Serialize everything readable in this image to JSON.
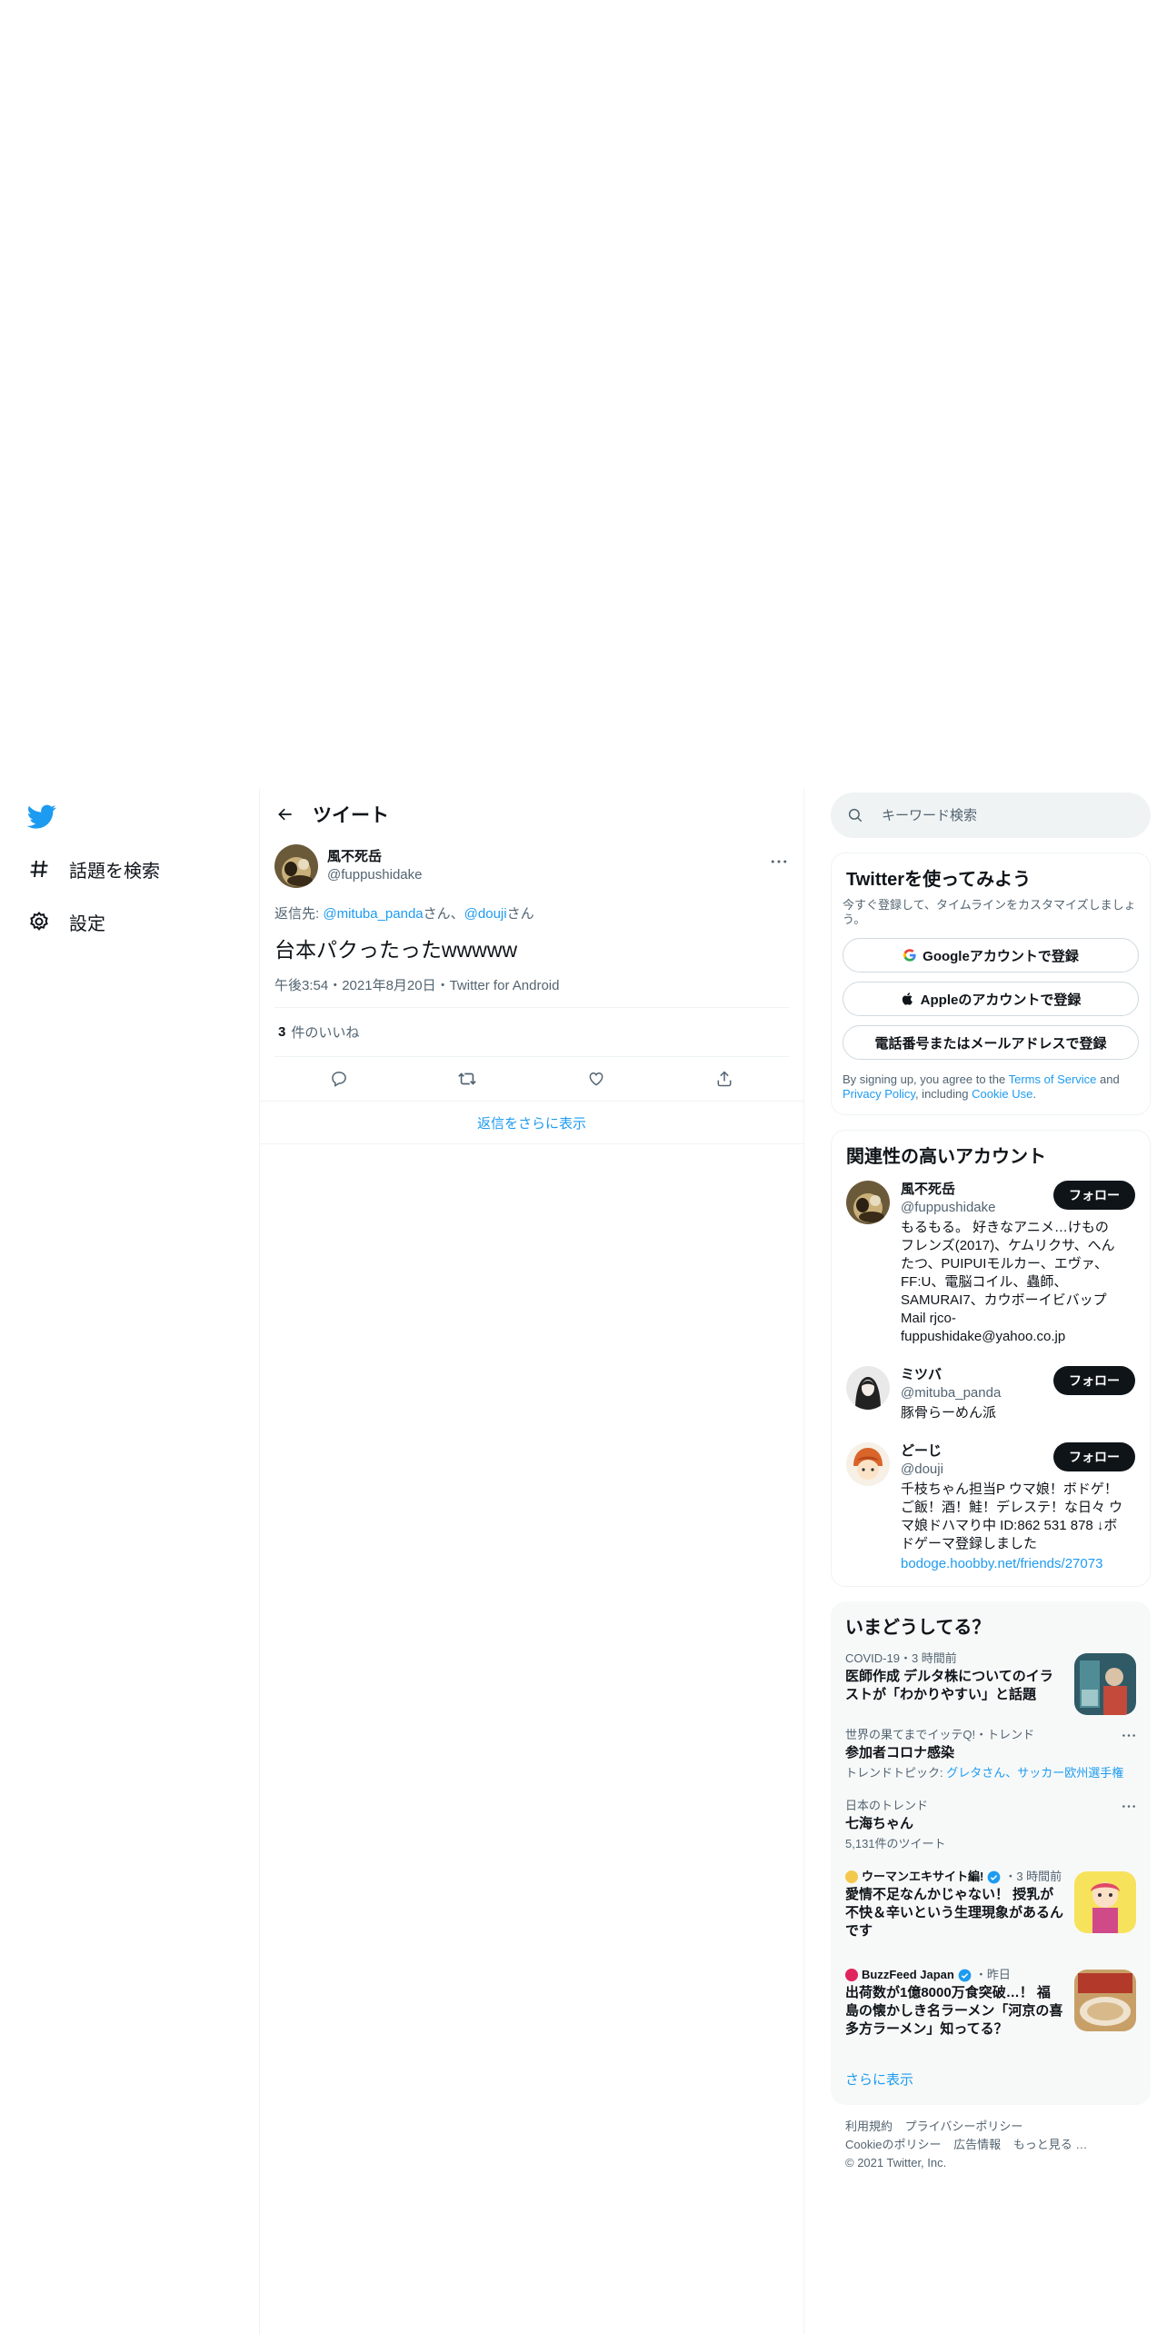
{
  "nav": {
    "items": [
      {
        "label": "話題を検索",
        "icon": "hashtag-icon"
      },
      {
        "label": "設定",
        "icon": "gear-icon"
      }
    ]
  },
  "header": {
    "title": "ツイート"
  },
  "tweet": {
    "name": "風不死岳",
    "handle": "@fuppushidake",
    "reply_prefix": "返信先: ",
    "reply_user1": "@mituba_panda",
    "reply_san1": "さん、",
    "reply_user2": "@douji",
    "reply_san2": "さん",
    "text": "台本パクったったwwwww",
    "meta": "午後3:54・2021年8月20日・Twitter for Android",
    "likes_count": "3",
    "likes_label": "件のいいね",
    "show_more_replies": "返信をさらに表示"
  },
  "search": {
    "placeholder": "キーワード検索"
  },
  "signup": {
    "title": "Twitterを使ってみよう",
    "subtitle": "今すぐ登録して、タイムラインをカスタマイズしましょう。",
    "google_btn": "Googleアカウントで登録",
    "apple_btn": "Appleのアカウントで登録",
    "phone_btn": "電話番号またはメールアドレスで登録",
    "legal_1": "By signing up, you agree to the ",
    "terms": "Terms of Service",
    "legal_2": " and ",
    "privacy": "Privacy Policy",
    "legal_3": ", including ",
    "cookie": "Cookie Use",
    "legal_4": "."
  },
  "related": {
    "title": "関連性の高いアカウント",
    "follow_label": "フォロー",
    "accounts": [
      {
        "name": "風不死岳",
        "handle": "@fuppushidake",
        "bio": "もるもる。 好きなアニメ…けものフレンズ(2017)、ケムリクサ、へんたつ、PUIPUIモルカー、エヴァ、FF:U、電脳コイル、蟲師、SAMURAI7、カウボーイビバップ Mail rjco-fuppushidake@yahoo.co.jp"
      },
      {
        "name": "ミツバ",
        "handle": "@mituba_panda",
        "bio": "豚骨らーめん派"
      },
      {
        "name": "どーじ",
        "handle": "@douji",
        "bio": "千枝ちゃん担当P ウマ娘！ボドゲ！ご飯！酒！鮭！デレステ！な日々 ウマ娘ドハマり中 ID:862 531 878 ↓ボドゲーマ登録しました",
        "link": "bodoge.hoobby.net/friends/27073"
      }
    ]
  },
  "trends": {
    "title": "いまどうしてる？",
    "items": [
      {
        "meta": "COVID-19・3 時間前",
        "title": "医師作成 デルタ株についてのイラストが「わかりやすい」と話題"
      },
      {
        "meta": "世界の果てまでイッテQ!・トレンド",
        "title": "参加者コロナ感染",
        "sub_prefix": "トレンドトピック: ",
        "sub_link": "グレタさん、サッカー欧州選手権"
      },
      {
        "meta": "日本のトレンド",
        "title": "七海ちゃん",
        "sub": "5,131件のツイート"
      },
      {
        "source": "ウーマンエキサイト編!",
        "time": "・3 時間前",
        "title": "愛情不足なんかじゃない！ 授乳が不快＆辛いという生理現象があるんです"
      },
      {
        "source": "BuzzFeed Japan",
        "time": "・昨日",
        "title": "出荷数が1億8000万食突破…！ 福島の懐かしき名ラーメン「河京の喜多方ラーメン」知ってる？"
      }
    ],
    "show_more": "さらに表示"
  },
  "footer": {
    "links": [
      "利用規約",
      "プライバシーポリシー",
      "Cookieのポリシー",
      "広告情報",
      "もっと見る …"
    ],
    "copyright": "© 2021 Twitter, Inc."
  },
  "colors": {
    "accent": "#1d9bf0",
    "text": "#0f1419",
    "muted": "#536471"
  }
}
